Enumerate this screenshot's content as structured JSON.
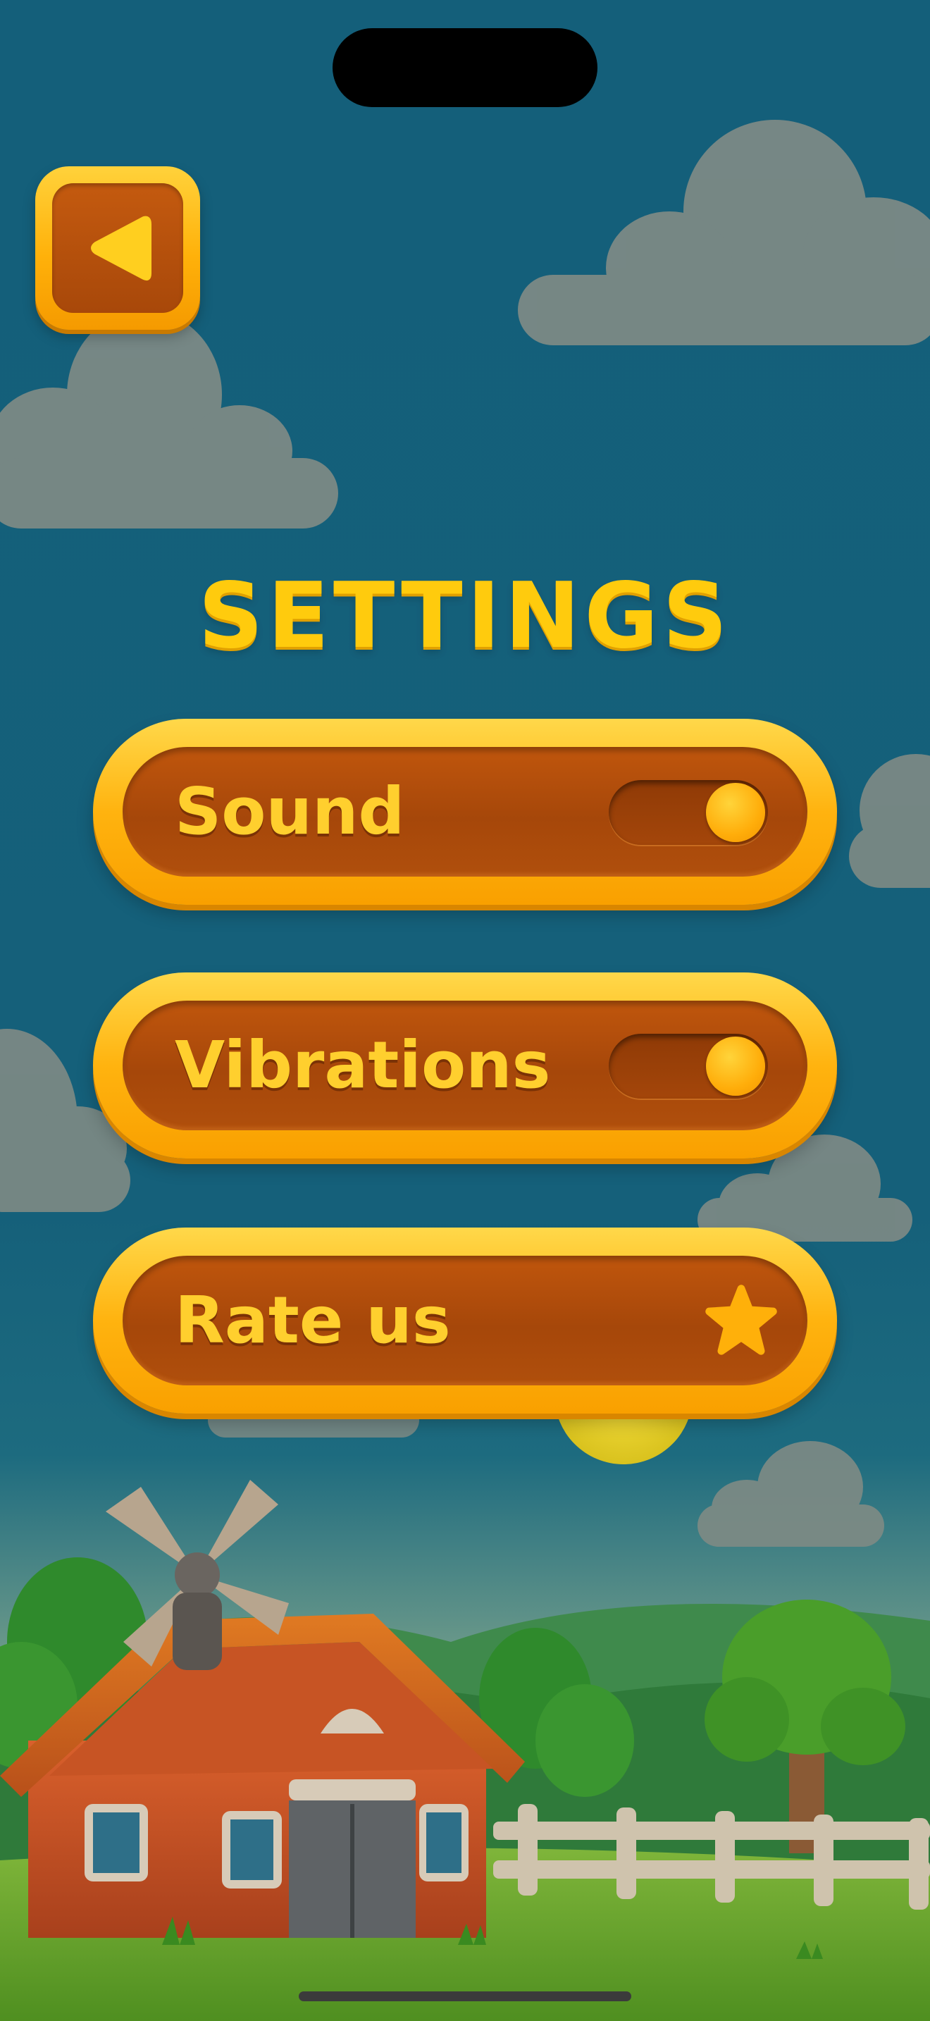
{
  "screen": {
    "title": "SETTINGS",
    "back_button": {
      "icon": "back-arrow-icon"
    },
    "settings": [
      {
        "id": "sound",
        "label": "Sound",
        "control": "toggle",
        "enabled": true
      },
      {
        "id": "vibrations",
        "label": "Vibrations",
        "control": "toggle",
        "enabled": true
      },
      {
        "id": "rate",
        "label": "Rate us",
        "control": "star",
        "icon": "star-icon"
      }
    ]
  },
  "colors": {
    "sky": "#145f7a",
    "title": "#ffcb0d",
    "pill_border": "#ffb30f",
    "pill_fill": "#a6470a",
    "label": "#ffcf2e"
  }
}
